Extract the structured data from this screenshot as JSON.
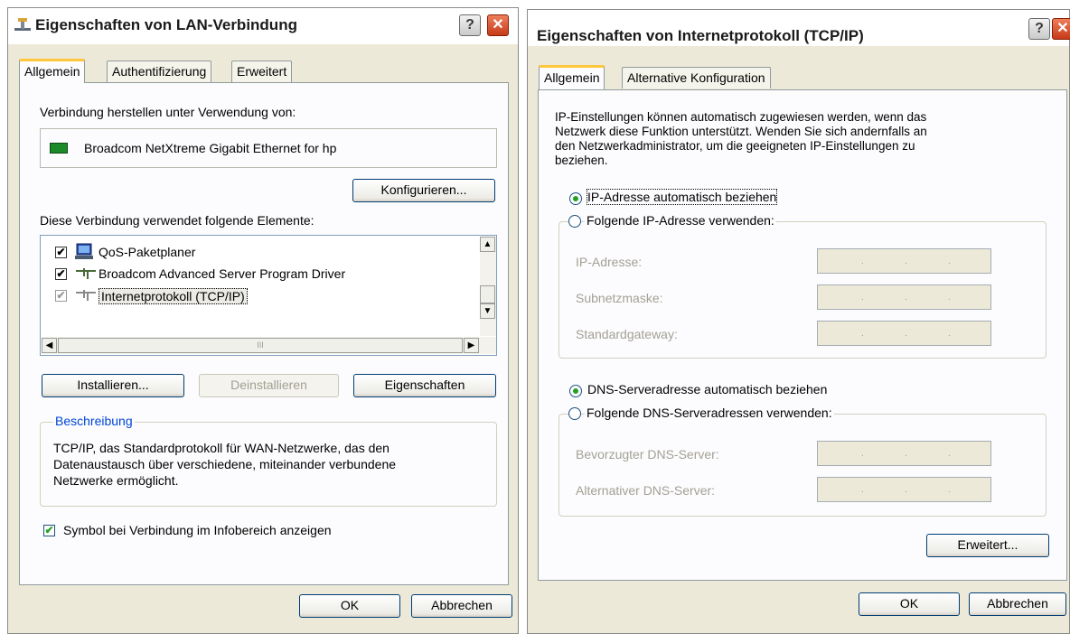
{
  "window1": {
    "title": "Eigenschaften von LAN-Verbindung",
    "tabs": [
      {
        "label": "Allgemein",
        "active": true
      },
      {
        "label": "Authentifizierung",
        "active": false
      },
      {
        "label": "Erweitert",
        "active": false
      }
    ],
    "connect_using_label": "Verbindung herstellen unter Verwendung von:",
    "adapter_name": "Broadcom NetXtreme Gigabit Ethernet for hp",
    "configure_button": "Konfigurieren...",
    "elements_label": "Diese Verbindung verwendet folgende Elemente:",
    "components": [
      {
        "label": "QoS-Paketplaner",
        "checked": true,
        "icon": "scheduler-icon"
      },
      {
        "label": "Broadcom Advanced Server Program Driver",
        "checked": true,
        "icon": "protocol-icon"
      },
      {
        "label": "Internetprotokoll (TCP/IP)",
        "checked": true,
        "icon": "protocol-icon",
        "selected": true
      }
    ],
    "install_button": "Installieren...",
    "uninstall_button": "Deinstallieren",
    "properties_button": "Eigenschaften",
    "description_legend": "Beschreibung",
    "description_text": [
      "TCP/IP, das Standardprotokoll für WAN-Netzwerke, das den",
      "Datenaustausch über verschiedene, miteinander verbundene",
      "Netzwerke ermöglicht."
    ],
    "show_icon_checkbox": "Symbol bei Verbindung im Infobereich anzeigen",
    "show_icon_checked": true,
    "ok_button": "OK",
    "cancel_button": "Abbrechen",
    "scrollbar_grip": "III"
  },
  "window2": {
    "title": "Eigenschaften von Internetprotokoll (TCP/IP)",
    "tabs": [
      {
        "label": "Allgemein",
        "active": true
      },
      {
        "label": "Alternative Konfiguration",
        "active": false
      }
    ],
    "intro_text": [
      "IP-Einstellungen können automatisch zugewiesen werden, wenn das",
      "Netzwerk diese Funktion unterstützt. Wenden Sie sich andernfalls an",
      "den Netzwerkadministrator, um die geeigneten IP-Einstellungen zu",
      "beziehen."
    ],
    "ip_auto_radio": "IP-Adresse automatisch beziehen",
    "ip_manual_radio": "Folgende IP-Adresse verwenden:",
    "ip_address_label": "IP-Adresse:",
    "subnet_label": "Subnetzmaske:",
    "gateway_label": "Standardgateway:",
    "dns_auto_radio": "DNS-Serveradresse automatisch beziehen",
    "dns_manual_radio": "Folgende DNS-Serveradressen verwenden:",
    "dns_preferred_label": "Bevorzugter DNS-Server:",
    "dns_alternate_label": "Alternativer DNS-Server:",
    "ip_mode": "automatic",
    "dns_mode": "automatic",
    "advanced_button": "Erweitert...",
    "ok_button": "OK",
    "cancel_button": "Abbrechen"
  },
  "colors": {
    "dialog_bg": "#ece9d8",
    "panel_bg": "#fcfcfe",
    "check_green": "#21a121",
    "close_red": "#d14a25",
    "group_legend_blue": "#0046d5"
  }
}
